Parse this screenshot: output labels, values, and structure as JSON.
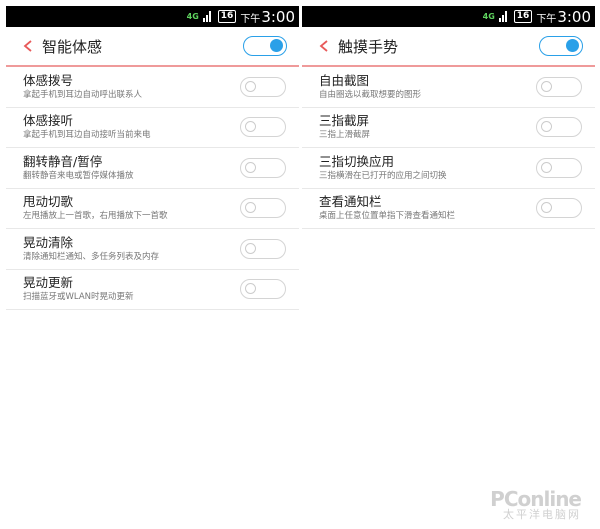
{
  "status": {
    "network": "4G",
    "battery": "16",
    "ampm": "下午",
    "clock": "3:00"
  },
  "left": {
    "title": "智能体感",
    "master_toggle": "on",
    "items": [
      {
        "label": "体感拨号",
        "desc": "拿起手机到耳边自动呼出联系人",
        "state": "off"
      },
      {
        "label": "体感接听",
        "desc": "拿起手机到耳边自动接听当前来电",
        "state": "off"
      },
      {
        "label": "翻转静音/暂停",
        "desc": "翻转静音来电或暂停媒体播放",
        "state": "off"
      },
      {
        "label": "甩动切歌",
        "desc": "左甩播放上一首歌，右甩播放下一首歌",
        "state": "off"
      },
      {
        "label": "晃动清除",
        "desc": "清除通知栏通知、多任务列表及内存",
        "state": "off"
      },
      {
        "label": "晃动更新",
        "desc": "扫描蓝牙或WLAN时晃动更新",
        "state": "off"
      }
    ]
  },
  "right": {
    "title": "触摸手势",
    "master_toggle": "on",
    "items": [
      {
        "label": "自由截图",
        "desc": "自由圈选以截取想要的图形",
        "state": "off"
      },
      {
        "label": "三指截屏",
        "desc": "三指上滑截屏",
        "state": "off"
      },
      {
        "label": "三指切换应用",
        "desc": "三指横滑在已打开的应用之间切换",
        "state": "off"
      },
      {
        "label": "查看通知栏",
        "desc": "桌面上任意位置单指下滑查看通知栏",
        "state": "off"
      }
    ]
  },
  "watermark": {
    "brand": "PConline",
    "sub": "太平洋电脑网"
  },
  "colors": {
    "accent": "#2aa0e8",
    "back_arrow": "#e85a5a",
    "header_line": "#ef9a9a",
    "network": "#5fd35f"
  }
}
